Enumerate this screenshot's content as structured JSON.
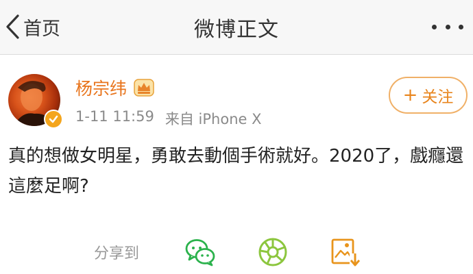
{
  "header": {
    "back_label": "首页",
    "title": "微博正文",
    "back_icon": "chevron-left-icon",
    "more_icon": "more-dots-icon"
  },
  "post": {
    "author": "杨宗纬",
    "author_color": "#e8741c",
    "badge_icon": "crown-icon",
    "verified_icon": "verified-check-icon",
    "time": "1-11 11:59",
    "source": "来自 iPhone X",
    "follow_label": "关注",
    "follow_plus": "+",
    "content": "真的想做女明星，勇敢去動個手術就好。2020了，戲癮還這麼足啊?"
  },
  "share": {
    "label": "分享到",
    "icons": [
      "wechat-icon",
      "moments-icon",
      "save-image-icon"
    ]
  }
}
